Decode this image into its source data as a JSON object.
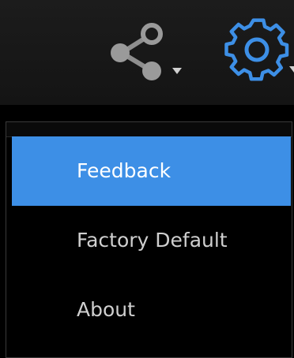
{
  "toolbar": {
    "share_icon": "share-icon",
    "settings_icon": "gear-icon",
    "accent_color": "#3d8fe6"
  },
  "menu": {
    "items": [
      {
        "label": "Feedback",
        "active": true
      },
      {
        "label": "Factory Default",
        "active": false
      },
      {
        "label": "About",
        "active": false
      }
    ]
  }
}
